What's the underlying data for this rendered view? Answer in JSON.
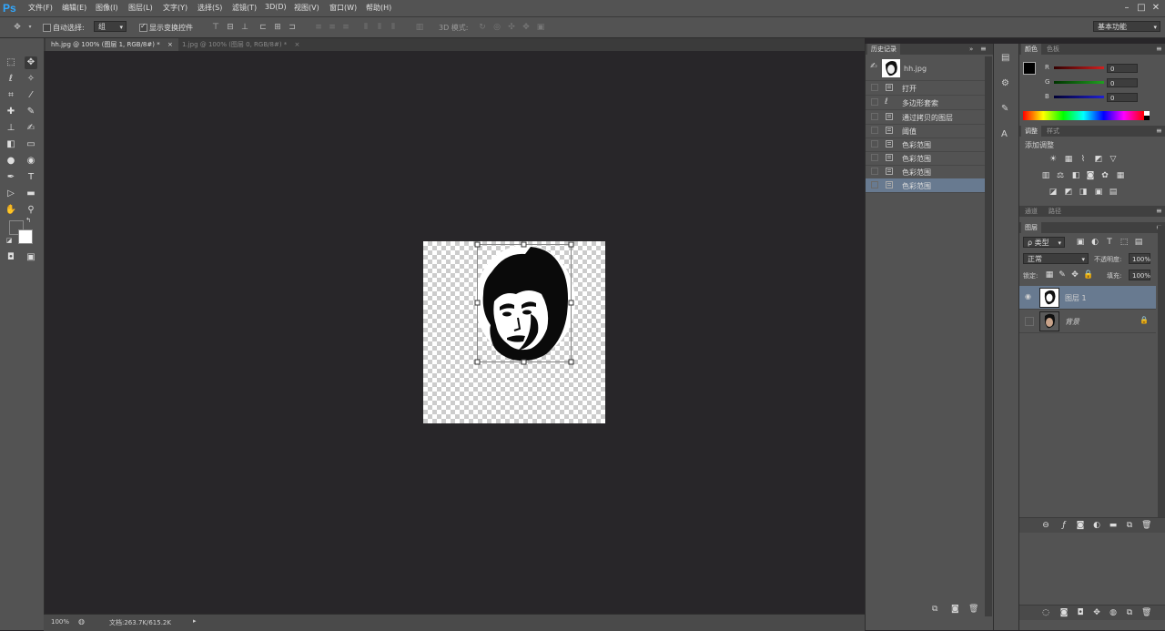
{
  "app": {
    "logo": "Ps"
  },
  "menu": [
    "文件(F)",
    "编辑(E)",
    "图像(I)",
    "图层(L)",
    "文字(Y)",
    "选择(S)",
    "滤镜(T)",
    "3D(D)",
    "视图(V)",
    "窗口(W)",
    "帮助(H)"
  ],
  "options": {
    "auto_select_label": "自动选择:",
    "auto_select_value": "组",
    "show_transform_label": "显示变换控件",
    "mode_3d_label": "3D 模式:",
    "workspace": "基本功能"
  },
  "tabs": [
    {
      "label": "hh.jpg @ 100% (图层 1, RGB/8#) *",
      "active": true
    },
    {
      "label": "1.jpg @ 100% (图层 0, RGB/8#) *",
      "active": false
    }
  ],
  "history": {
    "tab_label": "历史记录",
    "snapshot_label": "hh.jpg",
    "items": [
      {
        "label": "打开",
        "selected": false
      },
      {
        "label": "多边形套索",
        "selected": false
      },
      {
        "label": "通过拷贝的图层",
        "selected": false
      },
      {
        "label": "阈值",
        "selected": false
      },
      {
        "label": "色彩范围",
        "selected": false
      },
      {
        "label": "色彩范围",
        "selected": false
      },
      {
        "label": "色彩范围",
        "selected": false
      },
      {
        "label": "色彩范围",
        "selected": true
      }
    ]
  },
  "color_panel": {
    "tabs": [
      "颜色",
      "色板"
    ],
    "channels": [
      {
        "name": "R",
        "value": "0",
        "color": "#d02020"
      },
      {
        "name": "G",
        "value": "0",
        "color": "#20a020"
      },
      {
        "name": "B",
        "value": "0",
        "color": "#2020d0"
      }
    ]
  },
  "adjustments": {
    "tabs": [
      "调整",
      "样式"
    ],
    "title": "添加调整"
  },
  "channels_tabs": [
    "通道",
    "路径"
  ],
  "layers_panel": {
    "tab_label": "图层",
    "filter_kind": "ρ 类型",
    "blend_mode": "正常",
    "opacity_label": "不透明度:",
    "opacity": "100%",
    "lock_label": "锁定:",
    "fill_label": "填充:",
    "fill": "100%",
    "layers": [
      {
        "name": "图层 1",
        "selected": true,
        "visible": true,
        "locked": false
      },
      {
        "name": "背景",
        "selected": false,
        "visible": false,
        "locked": true
      }
    ]
  },
  "status": {
    "zoom": "100%",
    "doc_info": "文档:263.7K/615.2K"
  },
  "colors": {
    "foreground": "#000000",
    "background": "#ffffff",
    "selection": "#687a90"
  }
}
